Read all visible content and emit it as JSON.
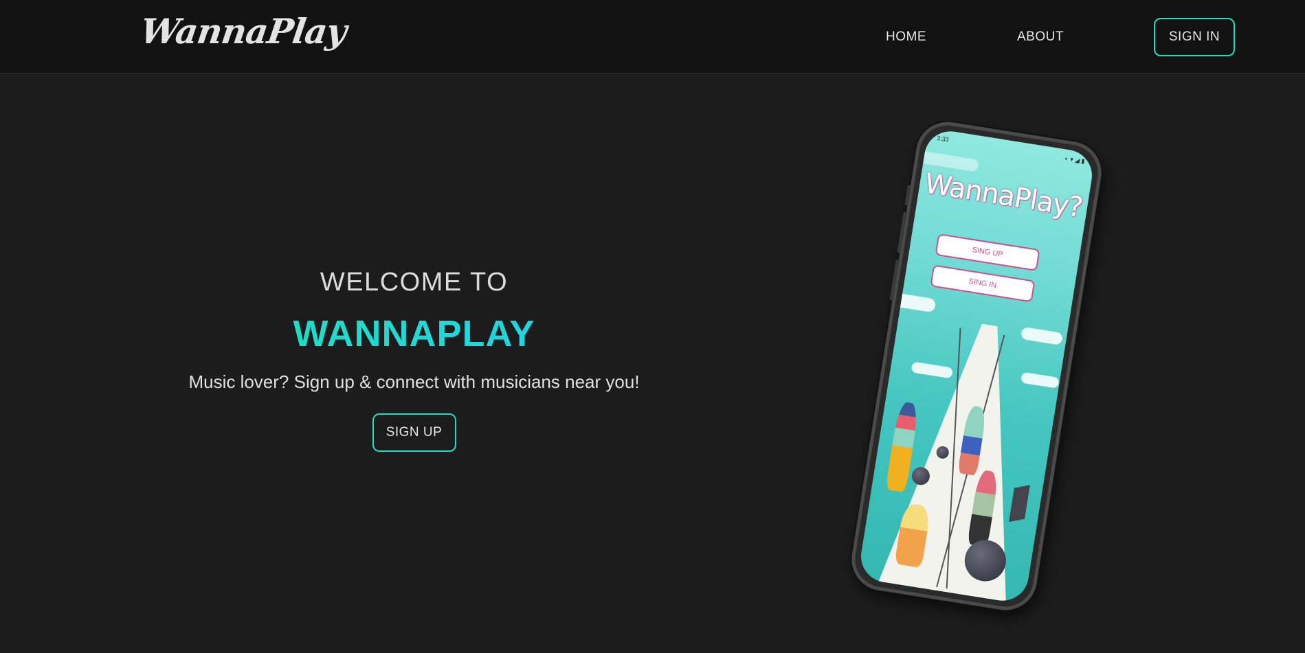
{
  "navbar": {
    "logo": "WannaPlay",
    "links": [
      {
        "label": "HOME"
      },
      {
        "label": "ABOUT"
      }
    ],
    "signin_label": "SIGN IN"
  },
  "hero": {
    "welcome": "WELCOME TO",
    "brand": "WANNAPLAY",
    "tagline": "Music lover? Sign up & connect with musicians near you!",
    "signup_label": "SIGN UP",
    "brand_gradient": [
      "#18e3b4",
      "#21c9ea"
    ],
    "accent_color": "#1de0c3"
  },
  "phone": {
    "status_time": "3:33",
    "app_title": "WannaPlay?",
    "app_signup_label": "SING UP",
    "app_signin_label": "SING IN"
  }
}
